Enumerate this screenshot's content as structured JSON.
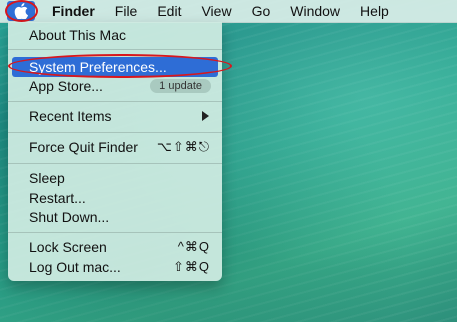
{
  "menubar": {
    "apple_icon": "apple-logo-icon",
    "items": [
      "Finder",
      "File",
      "Edit",
      "View",
      "Go",
      "Window",
      "Help"
    ]
  },
  "apple_menu": {
    "about": "About This Mac",
    "system_preferences": "System Preferences...",
    "app_store": "App Store...",
    "app_store_badge": "1 update",
    "recent_items": "Recent Items",
    "force_quit": "Force Quit Finder",
    "force_quit_shortcut": "⌥⇧⌘⎋",
    "sleep": "Sleep",
    "restart": "Restart...",
    "shut_down": "Shut Down...",
    "lock_screen": "Lock Screen",
    "lock_screen_shortcut": "^⌘Q",
    "log_out": "Log Out mac...",
    "log_out_shortcut": "⇧⌘Q"
  },
  "colors": {
    "highlight": "#2e6dd6",
    "annotation_circle": "#d8171d"
  }
}
